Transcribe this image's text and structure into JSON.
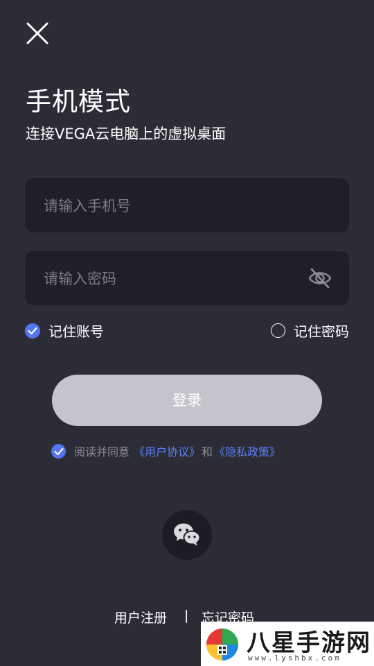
{
  "header": {
    "title": "手机模式",
    "subtitle": "连接VEGA云电脑上的虚拟桌面"
  },
  "form": {
    "phone_placeholder": "请输入手机号",
    "password_placeholder": "请输入密码",
    "remember_account": {
      "label": "记住账号",
      "checked": true
    },
    "remember_password": {
      "label": "记住密码",
      "checked": false
    },
    "login_label": "登录"
  },
  "agreement": {
    "checked": true,
    "prefix": "阅读并同意",
    "user_agreement": "《用户协议》",
    "and": "和",
    "privacy_policy": "《隐私政策》"
  },
  "social": {
    "icon": "wechat-icon"
  },
  "footer": {
    "register": "用户注册",
    "separator": "|",
    "forgot": "忘记密码"
  },
  "watermark": {
    "name": "八星手游网",
    "url": "www.lyshbx.com"
  },
  "colors": {
    "background": "#2c2c37",
    "field": "#1f1f29",
    "accent": "#5474f0",
    "link": "#5c7ff3",
    "button_disabled": "#c4c5cc"
  }
}
